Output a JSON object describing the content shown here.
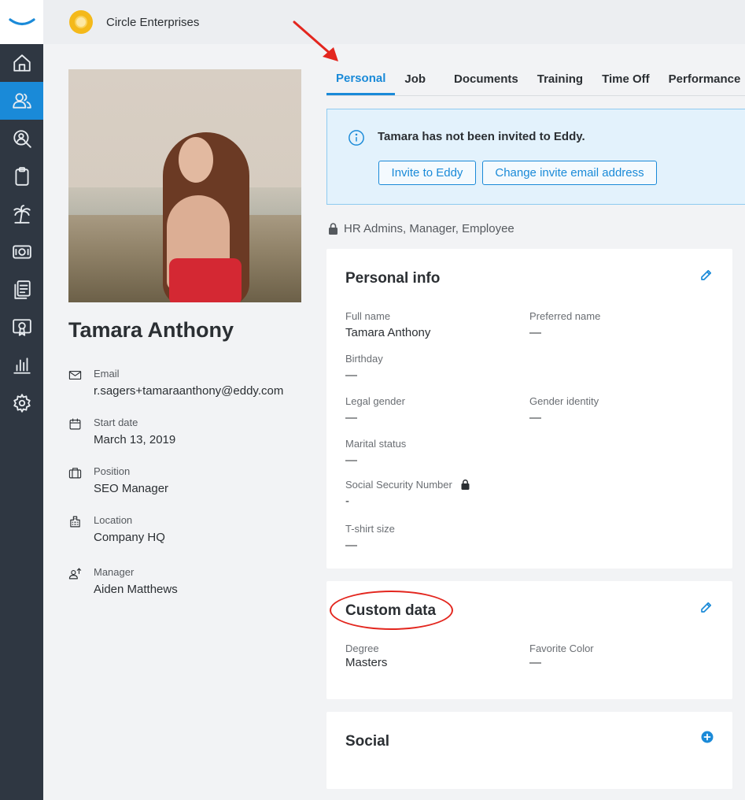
{
  "company": {
    "name": "Circle Enterprises"
  },
  "sidebar": {
    "items": [
      {
        "icon": "home-icon"
      },
      {
        "icon": "people-icon",
        "active": true
      },
      {
        "icon": "search-person-icon"
      },
      {
        "icon": "clipboard-icon"
      },
      {
        "icon": "palm-tree-icon"
      },
      {
        "icon": "money-icon"
      },
      {
        "icon": "documents-icon"
      },
      {
        "icon": "certificate-icon"
      },
      {
        "icon": "bar-chart-icon"
      },
      {
        "icon": "gear-icon"
      }
    ]
  },
  "profile": {
    "name": "Tamara Anthony",
    "email_label": "Email",
    "email": "r.sagers+tamaraanthony@eddy.com",
    "start_label": "Start date",
    "start": "March 13, 2019",
    "position_label": "Position",
    "position": "SEO Manager",
    "location_label": "Location",
    "location": "Company HQ",
    "manager_label": "Manager",
    "manager": "Aiden Matthews"
  },
  "tabs": [
    "Personal",
    "Job",
    "Documents",
    "Training",
    "Time Off",
    "Performance"
  ],
  "banner": {
    "message": "Tamara has not been invited to Eddy.",
    "invite_label": "Invite to Eddy",
    "change_label": "Change invite email address"
  },
  "access": "HR Admins, Manager, Employee",
  "personal_info": {
    "title": "Personal info",
    "full_name_label": "Full name",
    "full_name": "Tamara Anthony",
    "preferred_label": "Preferred name",
    "preferred": "—",
    "birthday_label": "Birthday",
    "birthday": "—",
    "legal_gender_label": "Legal gender",
    "legal_gender": "—",
    "gender_identity_label": "Gender identity",
    "gender_identity": "—",
    "marital_label": "Marital status",
    "marital": "—",
    "ssn_label": "Social Security Number",
    "ssn": "-",
    "tshirt_label": "T-shirt size",
    "tshirt": "—"
  },
  "custom_data": {
    "title": "Custom data",
    "degree_label": "Degree",
    "degree": "Masters",
    "color_label": "Favorite Color",
    "color": "—"
  },
  "social": {
    "title": "Social"
  },
  "colors": {
    "accent": "#1a8ad8",
    "sidebar": "#2f3742",
    "annotation": "#e3261e"
  }
}
